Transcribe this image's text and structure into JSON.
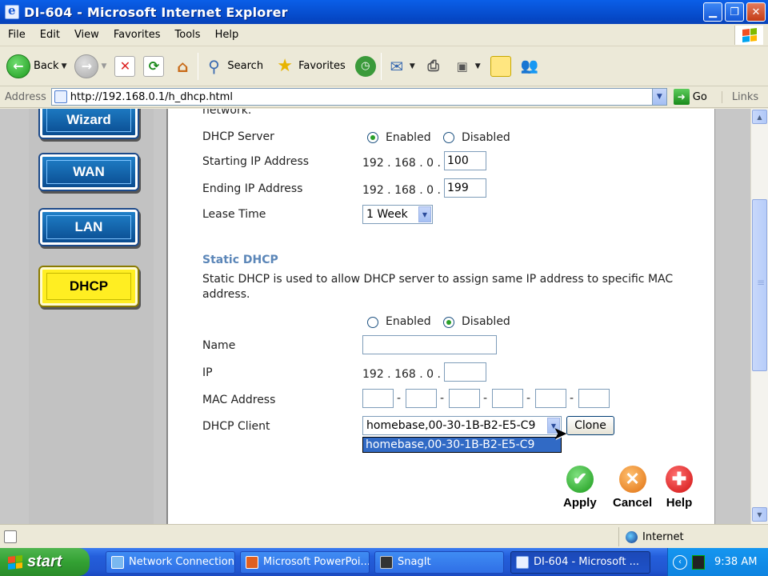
{
  "window": {
    "title": "DI-604 - Microsoft Internet Explorer"
  },
  "menu": [
    "File",
    "Edit",
    "View",
    "Favorites",
    "Tools",
    "Help"
  ],
  "toolbar": {
    "back": "Back",
    "search": "Search",
    "favorites": "Favorites"
  },
  "address": {
    "label": "Address",
    "url": "http://192.168.0.1/h_dhcp.html",
    "go": "Go",
    "links": "Links"
  },
  "nav": {
    "wizard": "Wizard",
    "wan": "WAN",
    "lan": "LAN",
    "dhcp": "DHCP"
  },
  "page": {
    "cut_text": "network.",
    "dhcp_server_label": "DHCP Server",
    "enabled": "Enabled",
    "disabled": "Disabled",
    "starting_ip_label": "Starting IP Address",
    "ending_ip_label": "Ending IP Address",
    "ip_prefix": "192 . 168 . 0 .",
    "starting_ip_value": "100",
    "ending_ip_value": "199",
    "lease_time_label": "Lease Time",
    "lease_time_value": "1 Week",
    "static_heading": "Static DHCP",
    "static_desc_1": "Static DHCP is used to allow DHCP server to assign same IP address to specific MAC",
    "static_desc_2": "address.",
    "name_label": "Name",
    "ip_label": "IP",
    "mac_label": "MAC Address",
    "mac_separator": "-",
    "client_label": "DHCP Client",
    "client_value": "homebase,00-30-1B-B2-E5-C9",
    "client_option": "homebase,00-30-1B-B2-E5-C9",
    "clone": "Clone",
    "apply": "Apply",
    "cancel": "Cancel",
    "help": "Help"
  },
  "status": {
    "zone": "Internet"
  },
  "taskbar": {
    "start": "start",
    "tasks": [
      "Network Connections",
      "Microsoft PowerPoi...",
      "SnagIt",
      "DI-604 - Microsoft ..."
    ],
    "clock": "9:38 AM"
  },
  "colors": {
    "accent_blue": "#0a5fe8",
    "heading": "#5b86b8",
    "dhcp_active": "#ffee22"
  }
}
